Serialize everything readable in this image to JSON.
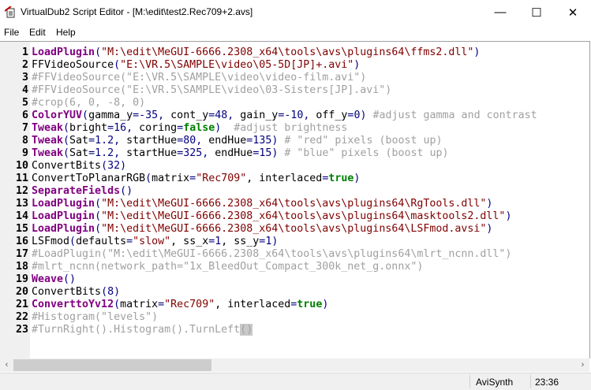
{
  "window": {
    "title": "VirtualDub2 Script Editor - [M:\\edit\\test2.Rec709+2.avs]",
    "minimize": "—",
    "maximize": "☐",
    "close": "✕"
  },
  "menu": [
    "File",
    "Edit",
    "Help"
  ],
  "colors": {
    "function": "#800080",
    "operator": "#000080",
    "string": "#800000",
    "keyword": "#008000",
    "comment": "#a0a0a0"
  },
  "editor": {
    "lines": [
      {
        "n": "1",
        "tokens": [
          {
            "c": "fn",
            "t": "LoadPlugin"
          },
          {
            "c": "op",
            "t": "("
          },
          {
            "c": "str",
            "t": "\"M:\\edit\\MeGUI-6666.2308_x64\\tools\\avs\\plugins64\\ffms2.dll\""
          },
          {
            "c": "op",
            "t": ")"
          }
        ]
      },
      {
        "n": "2",
        "tokens": [
          {
            "c": "pl",
            "t": "FFVideoSource"
          },
          {
            "c": "op",
            "t": "("
          },
          {
            "c": "str",
            "t": "\"E:\\VR.5\\SAMPLE\\video\\05-5D[JP]+.avi\""
          },
          {
            "c": "op",
            "t": ")"
          }
        ]
      },
      {
        "n": "3",
        "tokens": [
          {
            "c": "cm",
            "t": "#FFVideoSource(\"E:\\VR.5\\SAMPLE\\video\\video-film.avi\")"
          }
        ]
      },
      {
        "n": "4",
        "tokens": [
          {
            "c": "cm",
            "t": "#FFVideoSource(\"E:\\VR.5\\SAMPLE\\video\\03-Sisters[JP].avi\")"
          }
        ]
      },
      {
        "n": "5",
        "tokens": [
          {
            "c": "cm",
            "t": "#crop(6, 0, -8, 0)"
          }
        ]
      },
      {
        "n": "6",
        "tokens": [
          {
            "c": "fn",
            "t": "ColorYUV"
          },
          {
            "c": "op",
            "t": "("
          },
          {
            "c": "pl",
            "t": "gamma_y"
          },
          {
            "c": "op",
            "t": "="
          },
          {
            "c": "num",
            "t": "-35"
          },
          {
            "c": "op",
            "t": ","
          },
          {
            "c": "pl",
            "t": " cont_y"
          },
          {
            "c": "op",
            "t": "="
          },
          {
            "c": "num",
            "t": "48"
          },
          {
            "c": "op",
            "t": ","
          },
          {
            "c": "pl",
            "t": " gain_y"
          },
          {
            "c": "op",
            "t": "="
          },
          {
            "c": "num",
            "t": "-10"
          },
          {
            "c": "op",
            "t": ","
          },
          {
            "c": "pl",
            "t": " off_y"
          },
          {
            "c": "op",
            "t": "="
          },
          {
            "c": "num",
            "t": "0"
          },
          {
            "c": "op",
            "t": ")"
          },
          {
            "c": "pl",
            "t": " "
          },
          {
            "c": "cm",
            "t": "#adjust gamma and contrast"
          }
        ]
      },
      {
        "n": "7",
        "tokens": [
          {
            "c": "fn",
            "t": "Tweak"
          },
          {
            "c": "op",
            "t": "("
          },
          {
            "c": "pl",
            "t": "bright"
          },
          {
            "c": "op",
            "t": "="
          },
          {
            "c": "num",
            "t": "16"
          },
          {
            "c": "op",
            "t": ","
          },
          {
            "c": "pl",
            "t": " coring"
          },
          {
            "c": "op",
            "t": "="
          },
          {
            "c": "kw",
            "t": "false"
          },
          {
            "c": "op",
            "t": ")"
          },
          {
            "c": "pl",
            "t": "  "
          },
          {
            "c": "cm",
            "t": "#adjust brightness"
          }
        ]
      },
      {
        "n": "8",
        "tokens": [
          {
            "c": "fn",
            "t": "Tweak"
          },
          {
            "c": "op",
            "t": "("
          },
          {
            "c": "pl",
            "t": "Sat"
          },
          {
            "c": "op",
            "t": "="
          },
          {
            "c": "num",
            "t": "1.2"
          },
          {
            "c": "op",
            "t": ","
          },
          {
            "c": "pl",
            "t": " startHue"
          },
          {
            "c": "op",
            "t": "="
          },
          {
            "c": "num",
            "t": "80"
          },
          {
            "c": "op",
            "t": ","
          },
          {
            "c": "pl",
            "t": " endHue"
          },
          {
            "c": "op",
            "t": "="
          },
          {
            "c": "num",
            "t": "135"
          },
          {
            "c": "op",
            "t": ")"
          },
          {
            "c": "pl",
            "t": " "
          },
          {
            "c": "cm",
            "t": "# \"red\" pixels (boost up)"
          }
        ]
      },
      {
        "n": "9",
        "tokens": [
          {
            "c": "fn",
            "t": "Tweak"
          },
          {
            "c": "op",
            "t": "("
          },
          {
            "c": "pl",
            "t": "Sat"
          },
          {
            "c": "op",
            "t": "="
          },
          {
            "c": "num",
            "t": "1.2"
          },
          {
            "c": "op",
            "t": ","
          },
          {
            "c": "pl",
            "t": " startHue"
          },
          {
            "c": "op",
            "t": "="
          },
          {
            "c": "num",
            "t": "325"
          },
          {
            "c": "op",
            "t": ","
          },
          {
            "c": "pl",
            "t": " endHue"
          },
          {
            "c": "op",
            "t": "="
          },
          {
            "c": "num",
            "t": "15"
          },
          {
            "c": "op",
            "t": ")"
          },
          {
            "c": "pl",
            "t": " "
          },
          {
            "c": "cm",
            "t": "# \"blue\" pixels (boost up)"
          }
        ]
      },
      {
        "n": "10",
        "tokens": [
          {
            "c": "pl",
            "t": "ConvertBits"
          },
          {
            "c": "op",
            "t": "("
          },
          {
            "c": "num",
            "t": "32"
          },
          {
            "c": "op",
            "t": ")"
          }
        ]
      },
      {
        "n": "11",
        "tokens": [
          {
            "c": "pl",
            "t": "ConvertToPlanarRGB"
          },
          {
            "c": "op",
            "t": "("
          },
          {
            "c": "pl",
            "t": "matrix"
          },
          {
            "c": "op",
            "t": "="
          },
          {
            "c": "str",
            "t": "\"Rec709\""
          },
          {
            "c": "pl",
            "t": ", interlaced"
          },
          {
            "c": "op",
            "t": "="
          },
          {
            "c": "kw",
            "t": "true"
          },
          {
            "c": "op",
            "t": ")"
          }
        ]
      },
      {
        "n": "12",
        "tokens": [
          {
            "c": "fn",
            "t": "SeparateFields"
          },
          {
            "c": "op",
            "t": "()"
          }
        ]
      },
      {
        "n": "13",
        "tokens": [
          {
            "c": "fn",
            "t": "LoadPlugin"
          },
          {
            "c": "op",
            "t": "("
          },
          {
            "c": "str",
            "t": "\"M:\\edit\\MeGUI-6666.2308_x64\\tools\\avs\\plugins64\\RgTools.dll\""
          },
          {
            "c": "op",
            "t": ")"
          }
        ]
      },
      {
        "n": "14",
        "tokens": [
          {
            "c": "fn",
            "t": "LoadPlugin"
          },
          {
            "c": "op",
            "t": "("
          },
          {
            "c": "str",
            "t": "\"M:\\edit\\MeGUI-6666.2308_x64\\tools\\avs\\plugins64\\masktools2.dll\""
          },
          {
            "c": "op",
            "t": ")"
          }
        ]
      },
      {
        "n": "15",
        "tokens": [
          {
            "c": "fn",
            "t": "LoadPlugin"
          },
          {
            "c": "op",
            "t": "("
          },
          {
            "c": "str",
            "t": "\"M:\\edit\\MeGUI-6666.2308_x64\\tools\\avs\\plugins64\\LSFmod.avsi\""
          },
          {
            "c": "op",
            "t": ")"
          }
        ]
      },
      {
        "n": "16",
        "tokens": [
          {
            "c": "pl",
            "t": "LSFmod"
          },
          {
            "c": "op",
            "t": "("
          },
          {
            "c": "pl",
            "t": "defaults"
          },
          {
            "c": "op",
            "t": "="
          },
          {
            "c": "str",
            "t": "\"slow\""
          },
          {
            "c": "pl",
            "t": ", ss_x"
          },
          {
            "c": "op",
            "t": "="
          },
          {
            "c": "num",
            "t": "1"
          },
          {
            "c": "pl",
            "t": ", ss_y"
          },
          {
            "c": "op",
            "t": "="
          },
          {
            "c": "num",
            "t": "1"
          },
          {
            "c": "op",
            "t": ")"
          }
        ]
      },
      {
        "n": "17",
        "tokens": [
          {
            "c": "cm",
            "t": "#LoadPlugin(\"M:\\edit\\MeGUI-6666.2308_x64\\tools\\avs\\plugins64\\mlrt_ncnn.dll\")"
          }
        ]
      },
      {
        "n": "18",
        "tokens": [
          {
            "c": "cm",
            "t": "#mlrt_ncnn(network_path=\"1x_BleedOut_Compact_300k_net_g.onnx\")"
          }
        ]
      },
      {
        "n": "19",
        "tokens": [
          {
            "c": "fn",
            "t": "Weave"
          },
          {
            "c": "op",
            "t": "()"
          }
        ]
      },
      {
        "n": "20",
        "tokens": [
          {
            "c": "pl",
            "t": "ConvertBits"
          },
          {
            "c": "op",
            "t": "("
          },
          {
            "c": "num",
            "t": "8"
          },
          {
            "c": "op",
            "t": ")"
          }
        ]
      },
      {
        "n": "21",
        "tokens": [
          {
            "c": "fn",
            "t": "ConverttoYv12"
          },
          {
            "c": "op",
            "t": "("
          },
          {
            "c": "pl",
            "t": "matrix"
          },
          {
            "c": "op",
            "t": "="
          },
          {
            "c": "str",
            "t": "\"Rec709\""
          },
          {
            "c": "pl",
            "t": ", interlaced"
          },
          {
            "c": "op",
            "t": "="
          },
          {
            "c": "kw",
            "t": "true"
          },
          {
            "c": "op",
            "t": ")"
          }
        ]
      },
      {
        "n": "22",
        "tokens": [
          {
            "c": "cm",
            "t": "#Histogram(\"levels\")"
          }
        ]
      },
      {
        "n": "23",
        "tokens": [
          {
            "c": "cm",
            "t": "#TurnRight().Histogram().TurnLeft"
          },
          {
            "c": "hl",
            "t": "()"
          }
        ]
      }
    ]
  },
  "scrollbar": {
    "left_arrow": "‹",
    "right_arrow": "›"
  },
  "status": {
    "language": "AviSynth",
    "position": "23:36"
  }
}
